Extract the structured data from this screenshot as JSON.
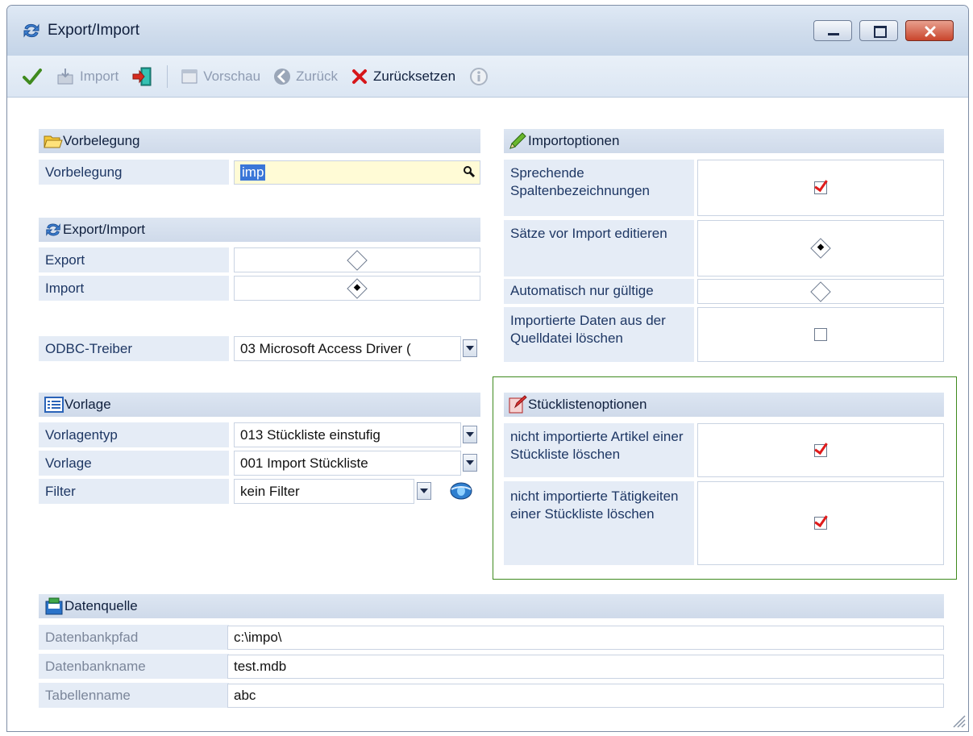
{
  "window": {
    "title": "Export/Import"
  },
  "toolbar": {
    "import_label": "Import",
    "preview_label": "Vorschau",
    "back_label": "Zurück",
    "reset_label": "Zurücksetzen"
  },
  "vorbelegung": {
    "header": "Vorbelegung",
    "label": "Vorbelegung",
    "value": "imp"
  },
  "export_import": {
    "header": "Export/Import",
    "export_label": "Export",
    "export_selected": false,
    "import_label": "Import",
    "import_selected": true
  },
  "odbc": {
    "label": "ODBC-Treiber",
    "value": "03 Microsoft Access Driver ("
  },
  "vorlage": {
    "header": "Vorlage",
    "type_label": "Vorlagentyp",
    "type_value": "013 Stückliste einstufig",
    "template_label": "Vorlage",
    "template_value": "001 Import Stückliste",
    "filter_label": "Filter",
    "filter_value": "kein Filter"
  },
  "importoptionen": {
    "header": "Importoptionen",
    "options": [
      {
        "label": "Sprechende Spaltenbezeichnungen",
        "control": "checkbox",
        "checked": true
      },
      {
        "label": "Sätze vor Import editieren",
        "control": "radio",
        "checked": true
      },
      {
        "label": "Automatisch nur gültige",
        "control": "radio",
        "checked": false
      },
      {
        "label": "Importierte Daten aus der Quelldatei löschen",
        "control": "checkbox",
        "checked": false
      }
    ]
  },
  "stuecklisten": {
    "header": "Stücklistenoptionen",
    "options": [
      {
        "label": "nicht importierte Artikel einer Stückliste löschen",
        "checked": true
      },
      {
        "label": "nicht importierte Tätigkeiten einer Stückliste löschen",
        "checked": true
      }
    ]
  },
  "datenquelle": {
    "header": "Datenquelle",
    "path_label": "Datenbankpfad",
    "path_value": "c:\\impo\\",
    "db_label": "Datenbankname",
    "db_value": "test.mdb",
    "table_label": "Tabellenname",
    "table_value": "abc"
  },
  "colors": {
    "accent_green": "#3f8a1e",
    "check_red": "#e01b1b",
    "section_bg": "#d6e0ee",
    "label_bg": "#e5ecf6"
  }
}
